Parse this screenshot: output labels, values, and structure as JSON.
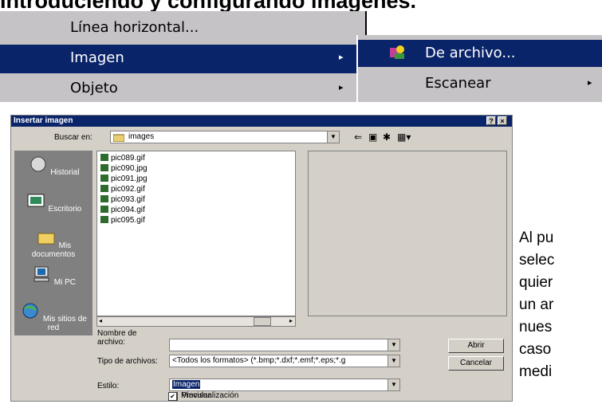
{
  "heading": "Introduciendo y configurando imágenes.",
  "menu": {
    "items": [
      {
        "label": "Línea horizontal...",
        "arrow": ""
      },
      {
        "label": "Imagen",
        "arrow": "▸"
      },
      {
        "label": "Objeto",
        "arrow": "▸"
      }
    ],
    "submenu": [
      {
        "label": "De archivo...",
        "icon": "image-file-icon"
      },
      {
        "label": "Escanear",
        "arrow": "▸"
      }
    ],
    "highlight_color": "#0a246a"
  },
  "dialog": {
    "title": "Insertar imagen",
    "help_btn": "?",
    "close_btn": "×",
    "look_in_label": "Buscar en:",
    "look_in_value": "images",
    "places": [
      "Historial",
      "Escritorio",
      "Mis documentos",
      "Mi PC",
      "Mis sitios de red"
    ],
    "files": [
      "pic089.gif",
      "pic090.jpg",
      "pic091.jpg",
      "pic092.gif",
      "pic093.gif",
      "pic094.gif",
      "pic095.gif"
    ],
    "filename_label": "Nombre de archivo:",
    "filename_value": "",
    "filetype_label": "Tipo de archivos:",
    "filetype_value": "<Todos los formatos> (*.bmp;*.dxf;*.emf;*.eps;*.g",
    "style_label": "Estilo:",
    "style_value": "Imagen",
    "open_button": "Abrir",
    "cancel_button": "Cancelar",
    "check_link": "Vincular",
    "check_preview": "Previsualización"
  },
  "paragraph": [
    "Al pu",
    "selec",
    "quier",
    "un ar",
    "nues",
    "caso",
    "medi"
  ]
}
